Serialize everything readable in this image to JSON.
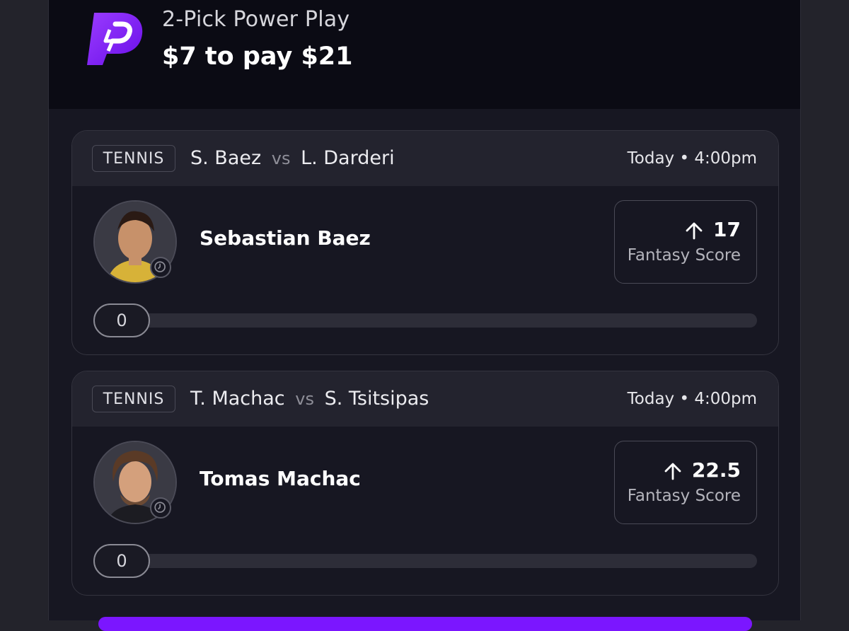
{
  "entry": {
    "type": "2-Pick Power Play",
    "amount": "$7 to pay $21"
  },
  "brand_color": "#7b16ff",
  "picks": [
    {
      "sport": "TENNIS",
      "team_a": "S. Baez",
      "vs": "vs",
      "team_b": "L. Darderi",
      "time": "Today • 4:00pm",
      "player": "Sebastian Baez",
      "direction_icon": "arrow-up-icon",
      "line": "17",
      "stat": "Fantasy Score",
      "current": "0",
      "progress": 0
    },
    {
      "sport": "TENNIS",
      "team_a": "T. Machac",
      "vs": "vs",
      "team_b": "S. Tsitsipas",
      "time": "Today • 4:00pm",
      "player": "Tomas Machac",
      "direction_icon": "arrow-up-icon",
      "line": "22.5",
      "stat": "Fantasy Score",
      "current": "0",
      "progress": 0
    }
  ]
}
